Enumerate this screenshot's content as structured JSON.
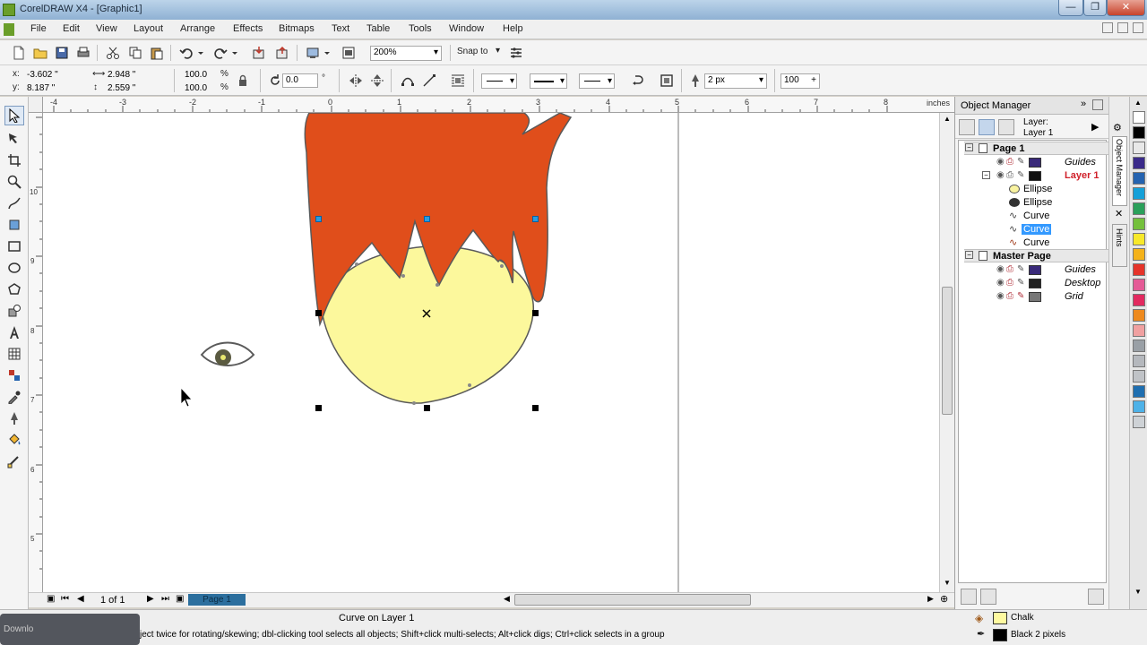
{
  "window": {
    "title": "CorelDRAW X4 - [Graphic1]",
    "controls": [
      "—",
      "❐",
      "✕"
    ]
  },
  "menu": {
    "items": [
      {
        "label": "File"
      },
      {
        "label": "Edit"
      },
      {
        "label": "View"
      },
      {
        "label": "Layout"
      },
      {
        "label": "Arrange"
      },
      {
        "label": "Effects"
      },
      {
        "label": "Bitmaps"
      },
      {
        "label": "Text"
      },
      {
        "label": "Table"
      },
      {
        "label": "Tools"
      },
      {
        "label": "Window"
      },
      {
        "label": "Help"
      }
    ]
  },
  "standard_toolbar": {
    "zoom_value": "200%",
    "snap_to_label": "Snap to"
  },
  "property_bar": {
    "x_label": "x:",
    "x_value": "-3.602 \"",
    "y_label": "y:",
    "y_value": "8.187 \"",
    "width_value": "2.948 \"",
    "height_value": "2.559 \"",
    "scale_x": "100.0",
    "scale_y": "100.0",
    "percent": "%",
    "rotation_value": "0.0",
    "degree": "°",
    "outline_width": "2 px",
    "smoothing_value": "100"
  },
  "rulers": {
    "unit_label": "inches",
    "h_ticks": [
      "-4",
      "-3",
      "-2",
      "-1",
      "0",
      "1",
      "2",
      "3",
      "4",
      "5",
      "6",
      "7",
      "8",
      "9"
    ],
    "v_ticks": [
      "10",
      "9",
      "8",
      "7",
      "6",
      "5"
    ]
  },
  "page_nav": {
    "counter": "1 of 1",
    "page_tab": "Page 1"
  },
  "docker": {
    "title": "Object Manager",
    "layer_top": "Layer:",
    "layer_name": "Layer 1",
    "tree": [
      {
        "label": "Page 1",
        "kind": "page"
      },
      {
        "label": "Guides",
        "kind": "layer",
        "color": "#3a2a7a"
      },
      {
        "label": "Layer 1",
        "kind": "layer-active",
        "color": "#111111"
      },
      {
        "label": "Ellipse",
        "kind": "object",
        "icon": "ellipse-outline-icon"
      },
      {
        "label": "Ellipse",
        "kind": "object",
        "icon": "ellipse-filled-icon"
      },
      {
        "label": "Curve",
        "kind": "object",
        "icon": "curve-icon"
      },
      {
        "label": "Curve",
        "kind": "object-selected",
        "icon": "curve-icon"
      },
      {
        "label": "Curve",
        "kind": "object",
        "icon": "curve-icon"
      },
      {
        "label": "Master Page",
        "kind": "page"
      },
      {
        "label": "Guides",
        "kind": "layer",
        "color": "#3a2a7a"
      },
      {
        "label": "Desktop",
        "kind": "layer",
        "color": "#222222"
      },
      {
        "label": "Grid",
        "kind": "layer",
        "color": "#777777"
      }
    ],
    "side_tabs": [
      "Object Manager",
      "Hints"
    ]
  },
  "palette": {
    "colors": [
      "#ffffff",
      "#000000",
      "#e8e8e8",
      "#3a2a8a",
      "#2563b0",
      "#15a0d8",
      "#2aa05a",
      "#74c03c",
      "#f7e82a",
      "#f4b21a",
      "#e5342a",
      "#e45a96",
      "#e22a60",
      "#ee8a1e",
      "#f0a0a0",
      "#9aa0a6",
      "#b5b8bd",
      "#c0c3c7",
      "#1e6eb0",
      "#4eb2e8",
      "#ced2d6"
    ]
  },
  "status": {
    "object_info": "Curve on Layer 1",
    "hint": "ject twice for rotating/skewing; dbl-clicking tool selects all objects; Shift+click multi-selects; Alt+click digs; Ctrl+click selects in a group",
    "fill_label": "Chalk",
    "fill_color": "#fffaa0",
    "outline_label": "Black  2 pixels",
    "taskbar_hint": "Downlo"
  },
  "colors": {
    "hair": "#e04e1b",
    "face": "#fcf89c",
    "outline": "#5a5a5a",
    "selection_blue": "#2a9ce0"
  }
}
